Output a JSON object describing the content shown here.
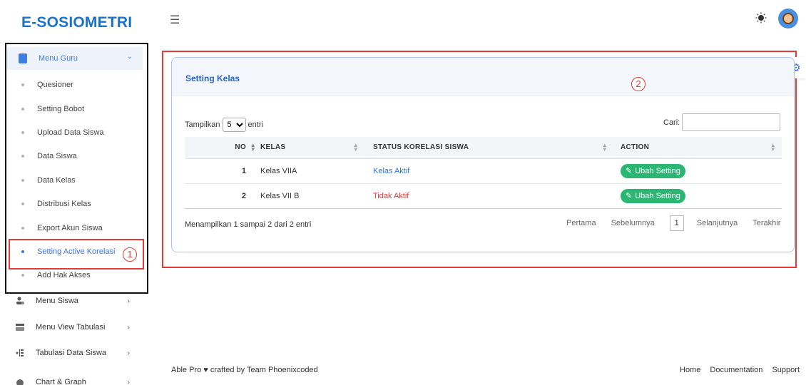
{
  "app": {
    "logo": "E-SOSIOMETRI"
  },
  "sidebar": {
    "menu_guru": {
      "label": "Menu Guru"
    },
    "sub_items": [
      {
        "label": "Quesioner"
      },
      {
        "label": "Setting Bobot"
      },
      {
        "label": "Upload Data Siswa"
      },
      {
        "label": "Data Siswa"
      },
      {
        "label": "Data Kelas"
      },
      {
        "label": "Distribusi Kelas"
      },
      {
        "label": "Export Akun Siswa"
      },
      {
        "label": "Setting Active Korelasi"
      },
      {
        "label": "Add Hak Akses"
      }
    ],
    "main_items": [
      {
        "label": "Menu Siswa"
      },
      {
        "label": "Menu View Tabulasi"
      },
      {
        "label": "Tabulasi Data Siswa"
      },
      {
        "label": "Chart & Graph"
      }
    ],
    "active_sub_item": "Setting Active Korelasi"
  },
  "annotations": {
    "mark1": "1",
    "mark2": "2"
  },
  "card": {
    "title": "Setting Kelas",
    "show_label": "Tampilkan",
    "show_value": "5",
    "entries_label": "entri",
    "search_label": "Cari:",
    "search_value": "",
    "columns": [
      "NO",
      "KELAS",
      "STATUS KORELASI SISWA",
      "ACTION"
    ],
    "rows": [
      {
        "no": "1",
        "kelas": "Kelas VIIA",
        "status": "Kelas Aktif",
        "action": "Ubah Setting"
      },
      {
        "no": "2",
        "kelas": "Kelas VII B",
        "status": "Tidak Aktif",
        "action": "Ubah Setting"
      }
    ],
    "info": "Menampilkan 1 sampai 2 dari 2 entri",
    "pager": {
      "first": "Pertama",
      "prev": "Sebelumnya",
      "current": "1",
      "next": "Selanjutnya",
      "last": "Terakhir"
    }
  },
  "footer": {
    "credit": "Able Pro ♥ crafted by Team Phoenixcoded",
    "links": [
      "Home",
      "Documentation",
      "Support"
    ]
  },
  "colors": {
    "primary": "#3f7fe0",
    "success": "#2bb673",
    "danger": "#e53935"
  }
}
